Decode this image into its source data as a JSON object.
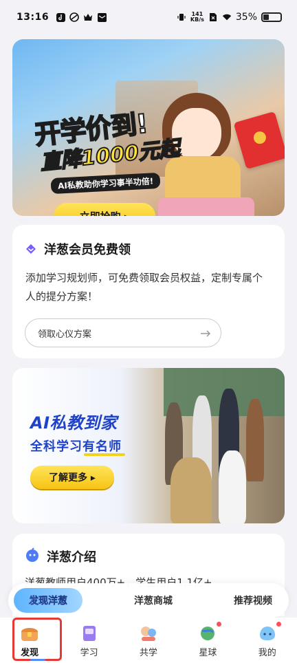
{
  "status": {
    "time": "13:16",
    "net_speed": "141",
    "net_unit": "KB/s",
    "battery": "35%",
    "battery_level": 0.35
  },
  "banner1": {
    "title1": "开学价到!",
    "title2": "直降1000元起",
    "subtitle": "AI私教助你学习事半功倍!",
    "cta": "立即抢购 ▸"
  },
  "card_member": {
    "title": "洋葱会员免费领",
    "desc": "添加学习规划师，可免费领取会员权益，定制专属个人的提分方案！",
    "action": "领取心仪方案",
    "accent": "#7b5cff"
  },
  "banner3": {
    "title": "AI私教到家",
    "subtitle": "全科学习有名师",
    "cta": "了解更多 ▸"
  },
  "card_intro": {
    "title": "洋葱介绍",
    "peek": "洋葱教师用户400万+，学生用户1.1亿+"
  },
  "float_tabs": [
    {
      "label": "发现洋葱",
      "active": true
    },
    {
      "label": "洋葱商城",
      "active": false
    },
    {
      "label": "推荐视频",
      "active": false
    }
  ],
  "nav": [
    {
      "label": "发现",
      "icon": "treasure-chest-icon",
      "active": true
    },
    {
      "label": "学习",
      "icon": "book-icon",
      "active": false
    },
    {
      "label": "共学",
      "icon": "study-together-icon",
      "active": false
    },
    {
      "label": "星球",
      "icon": "planet-icon",
      "active": false,
      "dot": true
    },
    {
      "label": "我的",
      "icon": "profile-blob-icon",
      "active": false,
      "dot": true
    }
  ]
}
